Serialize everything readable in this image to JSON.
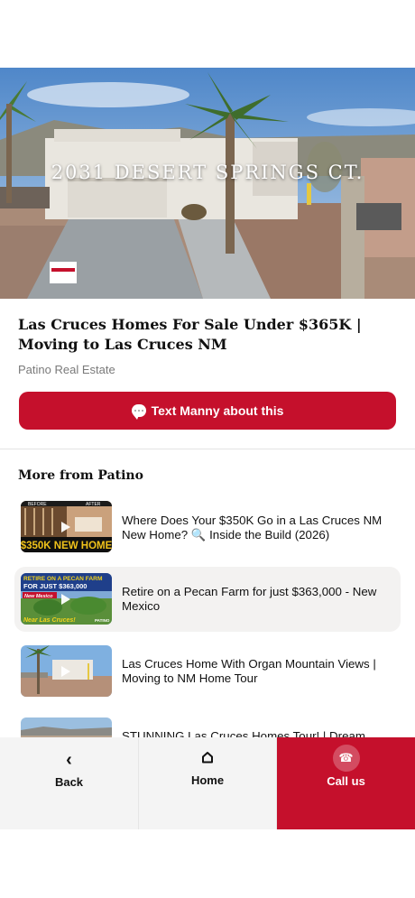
{
  "video": {
    "caption": "2031 DESERT SPRINGS CT.",
    "title": "Las Cruces Homes For Sale Under $365K | Moving to Las Cruces NM",
    "channel": "Patino Real Estate"
  },
  "cta": {
    "label": "Text Manny about this",
    "icon": "chat-bubble-icon"
  },
  "more": {
    "title": "More from Patino",
    "items": [
      {
        "title": "Where Does Your $350K Go in a Las Cruces NM New Home? 🔍 Inside the Build (2026)",
        "thumb": {
          "top_left": "BEFORE",
          "top_right": "AFTER",
          "banner": "$350K NEW HOME"
        }
      },
      {
        "title": "Retire on a Pecan Farm for just $363,000 - New Mexico",
        "thumb": {
          "line1": "RETIRE ON A PECAN FARM",
          "line2": "FOR JUST $363,000",
          "tag": "New Mexico",
          "bottom": "Near Las Cruces!",
          "brand": "PATINO"
        }
      },
      {
        "title": "Las Cruces Home With Organ Mountain Views | Moving to NM Home Tour",
        "thumb": {}
      },
      {
        "title": "STUNNING Las Cruces Homes Tour! | Dream",
        "thumb": {}
      }
    ]
  },
  "nav": {
    "back": {
      "label": "Back",
      "icon": "chevron-left-icon"
    },
    "home": {
      "label": "Home",
      "icon": "home-icon"
    },
    "call": {
      "label": "Call us",
      "icon": "phone-icon"
    }
  },
  "colors": {
    "brand_red": "#c5102c",
    "active_row_bg": "#f3f2f1",
    "nav_bg": "#f4f4f4"
  }
}
